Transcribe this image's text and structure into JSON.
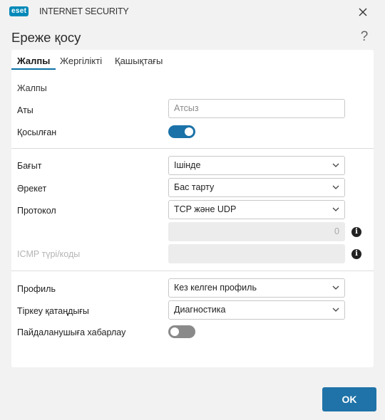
{
  "window": {
    "brand_logo": "eset",
    "product_name": "INTERNET SECURITY",
    "title": "Ереже қосу",
    "help_glyph": "?"
  },
  "tabs": [
    {
      "label": "Жалпы",
      "active": true
    },
    {
      "label": "Жергілікті",
      "active": false
    },
    {
      "label": "Қашықтағы",
      "active": false
    }
  ],
  "form": {
    "section_general": "Жалпы",
    "name_label": "Аты",
    "name_placeholder": "Атсыз",
    "enabled_label": "Қосылған",
    "enabled": true,
    "direction_label": "Бағыт",
    "direction_value": "Ішінде",
    "action_label": "Әрекет",
    "action_value": "Бас тарту",
    "protocol_label": "Протокол",
    "protocol_value": "TCP және UDP",
    "protocol_number": "0",
    "icmp_label": "ICMP түрі/коды",
    "icmp_value": "",
    "profile_label": "Профиль",
    "profile_value": "Кез келген профиль",
    "logging_label": "Тіркеу қатаңдығы",
    "logging_value": "Диагностика",
    "notify_label": "Пайдаланушыға хабарлау",
    "notify": false
  },
  "footer": {
    "ok_label": "OK"
  },
  "icons": {
    "close": "close-icon",
    "help": "help-icon",
    "chevron": "chevron-down-icon",
    "info": "info-icon"
  },
  "colors": {
    "accent": "#1f73a8",
    "toggle_on": "#1a72a8",
    "toggle_off": "#8a8a8a",
    "brand": "#0088b8"
  }
}
